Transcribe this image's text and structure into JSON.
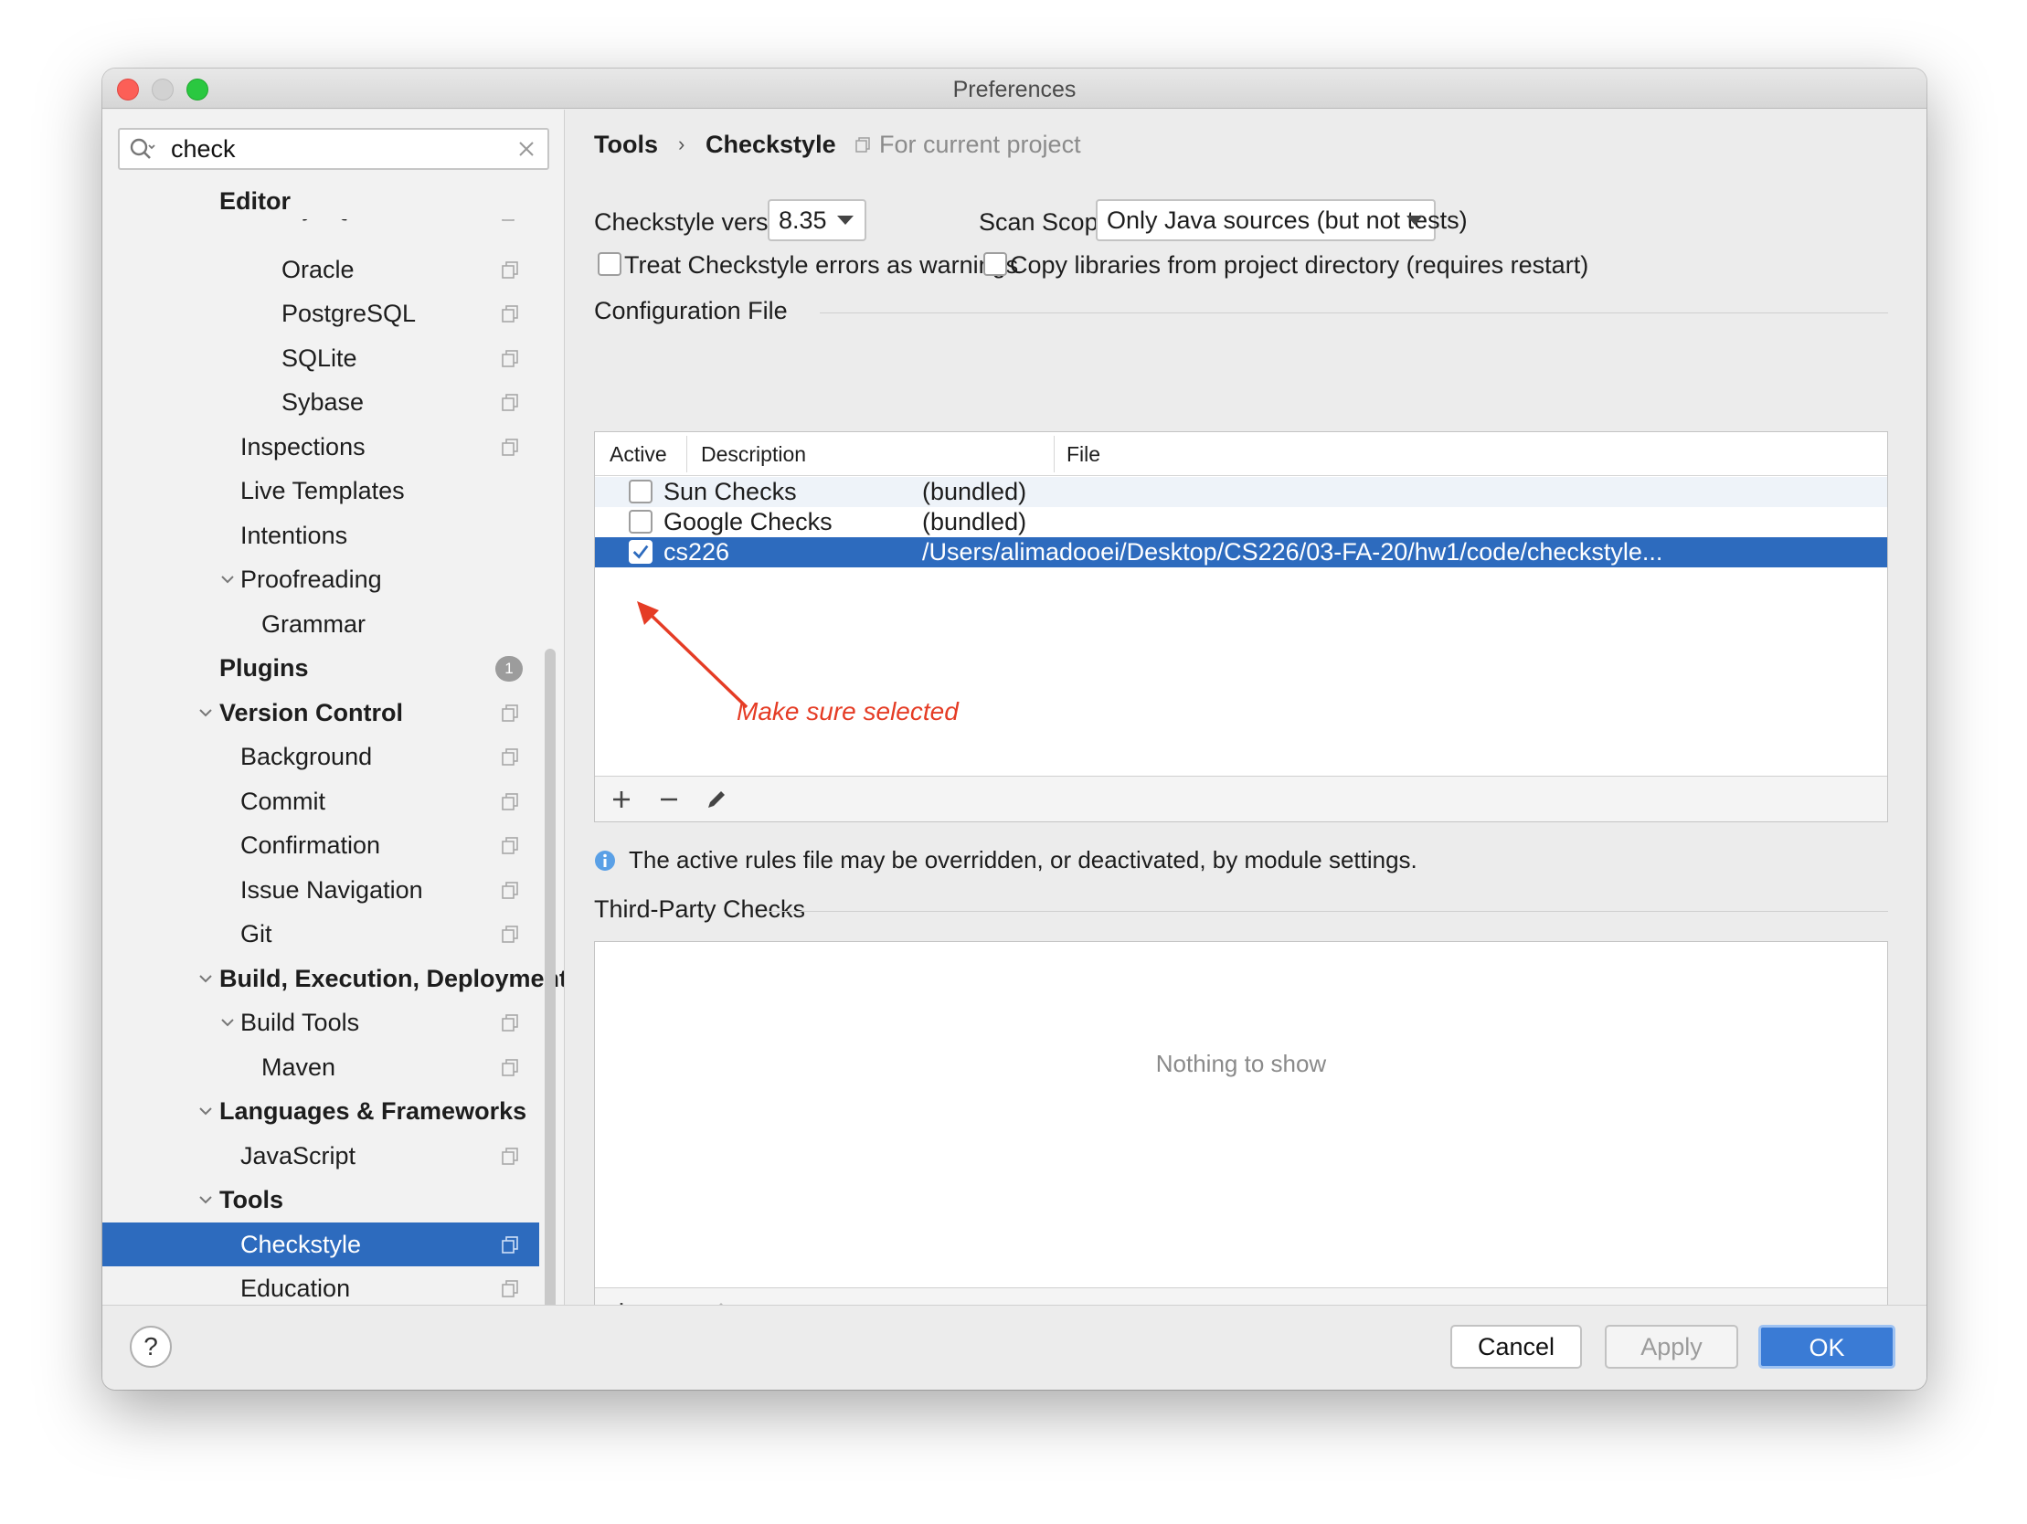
{
  "window": {
    "title": "Preferences"
  },
  "search": {
    "value": "check",
    "placeholder": ""
  },
  "sidebar": {
    "items": [
      {
        "label": "Editor",
        "level": 0,
        "bold": true
      },
      {
        "label": "MySQL",
        "level": 2
      },
      {
        "label": "Oracle",
        "level": 2
      },
      {
        "label": "PostgreSQL",
        "level": 2
      },
      {
        "label": "SQLite",
        "level": 2
      },
      {
        "label": "Sybase",
        "level": 2
      },
      {
        "label": "Inspections",
        "level": 1
      },
      {
        "label": "Live Templates",
        "level": 1
      },
      {
        "label": "Intentions",
        "level": 1
      },
      {
        "label": "Proofreading",
        "level": 1
      },
      {
        "label": "Grammar",
        "level": 2
      },
      {
        "label": "Plugins",
        "level": 0,
        "bold": true,
        "badge": "1"
      },
      {
        "label": "Version Control",
        "level": 0,
        "bold": true
      },
      {
        "label": "Background",
        "level": 1
      },
      {
        "label": "Commit",
        "level": 1
      },
      {
        "label": "Confirmation",
        "level": 1
      },
      {
        "label": "Issue Navigation",
        "level": 1
      },
      {
        "label": "Git",
        "level": 1
      },
      {
        "label": "Build, Execution, Deployment",
        "level": 0,
        "bold": true
      },
      {
        "label": "Build Tools",
        "level": 1
      },
      {
        "label": "Maven",
        "level": 2
      },
      {
        "label": "Languages & Frameworks",
        "level": 0,
        "bold": true
      },
      {
        "label": "JavaScript",
        "level": 1
      },
      {
        "label": "Tools",
        "level": 0,
        "bold": true
      },
      {
        "label": "Checkstyle",
        "level": 1,
        "selected": true
      },
      {
        "label": "Education",
        "level": 1
      }
    ]
  },
  "breadcrumb": {
    "parent": "Tools",
    "separator": "›",
    "current": "Checkstyle",
    "scope": "For current project"
  },
  "settings": {
    "version_label": "Checkstyle version:",
    "version_value": "8.35",
    "scope_label": "Scan Scope:",
    "scope_value": "Only Java sources (but not tests)",
    "treat_warnings_label": "Treat Checkstyle errors as warnings",
    "treat_warnings_checked": false,
    "copy_libs_label": "Copy libraries from project directory (requires restart)",
    "copy_libs_checked": false
  },
  "config_file": {
    "title": "Configuration File",
    "columns": [
      "Active",
      "Description",
      "File"
    ],
    "rows": [
      {
        "active": false,
        "description": "Sun Checks",
        "file": "(bundled)"
      },
      {
        "active": false,
        "description": "Google Checks",
        "file": "(bundled)"
      },
      {
        "active": true,
        "description": "cs226",
        "file": "/Users/alimadooei/Desktop/CS226/03-FA-20/hw1/code/checkstyle..."
      }
    ],
    "annotation": "Make sure selected"
  },
  "info": {
    "text": "The active rules file may be overridden, or deactivated, by module settings."
  },
  "third_party": {
    "title": "Third-Party Checks",
    "empty_text": "Nothing to show"
  },
  "footer": {
    "help": "?",
    "cancel": "Cancel",
    "apply": "Apply",
    "ok": "OK"
  },
  "colors": {
    "selection": "#2d6bbe",
    "annotation": "#e53c25",
    "primary_button": "#3a7bd5"
  }
}
